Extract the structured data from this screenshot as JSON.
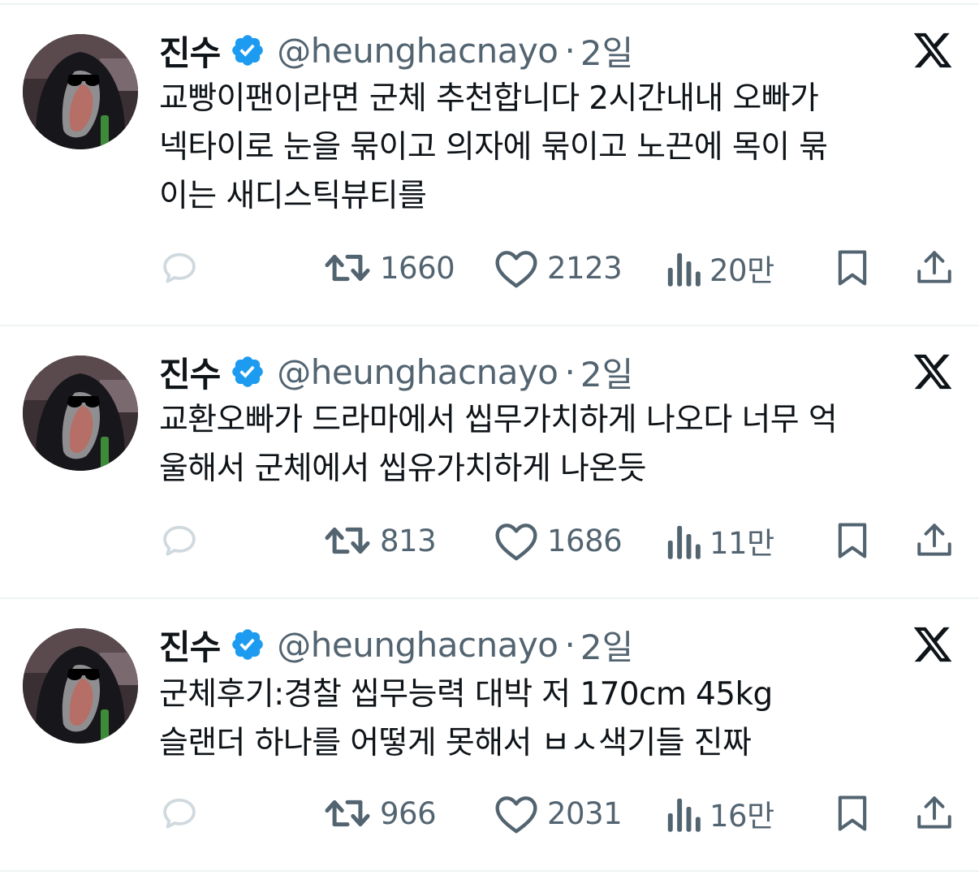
{
  "tweets": [
    {
      "author_name": "진수",
      "handle": "@heunghacnayo",
      "time": "2일",
      "text": "교빵이팬이라면 군체 추천합니다 2시간내내 오빠가\n넥타이로 눈을 묶이고 의자에 묶이고 노끈에 목이 묶\n이는 새디스틱뷰티를",
      "retweets": "1660",
      "likes": "2123",
      "views": "20만"
    },
    {
      "author_name": "진수",
      "handle": "@heunghacnayo",
      "time": "2일",
      "text": "교환오빠가 드라마에서 씹무가치하게 나오다 너무 억\n울해서 군체에서 씹유가치하게 나온듯",
      "retweets": "813",
      "likes": "1686",
      "views": "11만"
    },
    {
      "author_name": "진수",
      "handle": "@heunghacnayo",
      "time": "2일",
      "text": "군체후기:경찰 씹무능력 대박 저 170cm 45kg\n슬랜더 하나를 어떻게 못해서 ㅂㅅ색기들 진짜",
      "retweets": "966",
      "likes": "2031",
      "views": "16만"
    }
  ],
  "icons": {
    "verified": "verified-badge-icon",
    "platform": "x-logo-icon",
    "reply": "reply-icon",
    "retweet": "retweet-icon",
    "like": "heart-icon",
    "views": "views-chart-icon",
    "bookmark": "bookmark-icon",
    "share": "share-icon"
  },
  "colors": {
    "text": "#0f1419",
    "secondary": "#536471",
    "verified": "#1d9bf0",
    "divider": "#eff3f4"
  }
}
